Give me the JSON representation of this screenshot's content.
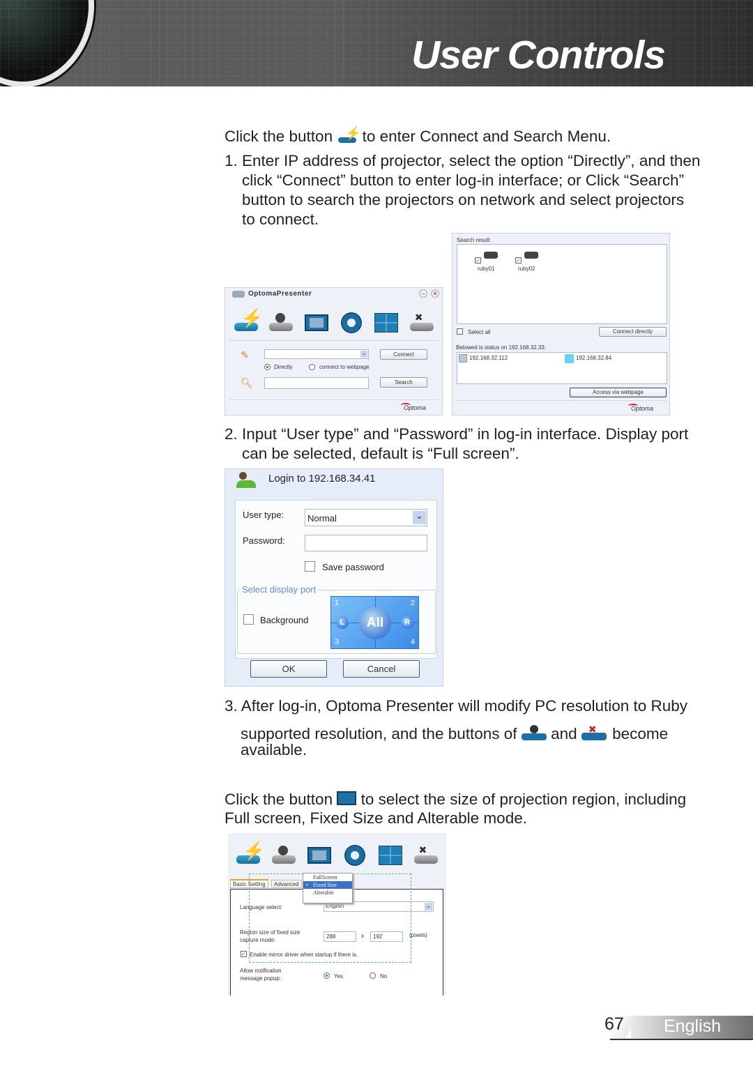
{
  "header": {
    "title": "User Controls"
  },
  "body": {
    "intro_a": "Click the button",
    "intro_b": "to enter Connect and Search Menu.",
    "step1": [
      "1. Enter IP address of projector, select the option “Directly”, and then",
      "click “Connect” button to enter log-in interface; or Click “Search”",
      "button to search the projectors on network and select projectors",
      "to connect."
    ],
    "step2": [
      "2. Input “User type” and “Password” in log-in interface. Display port",
      "can be selected, default is “Full screen”."
    ],
    "step3_a": "3. After log-in, Optoma Presenter will modify PC resolution to Ruby",
    "step3_b": "supported resolution, and the buttons of",
    "step3_and": "and",
    "step3_c": "become",
    "step3_d": "available.",
    "region_a": "Click the button",
    "region_b": "to select the size of projection region, including",
    "region_c": "Full screen, Fixed Size and Alterable mode."
  },
  "presenter": {
    "title": "OptomaPresenter",
    "connect": "Connect",
    "search": "Search",
    "radio_directly": "Directly",
    "radio_webpage": "connect to webpage",
    "logo": "Optoma",
    "icons": [
      "connect-search-icon",
      "play-projector-icon",
      "display-region-icon",
      "settings-gear-icon",
      "split-screen-icon",
      "disconnect-projector-icon"
    ]
  },
  "search_panel": {
    "label": "Search result:",
    "devices": [
      {
        "name": "ruby01",
        "checked": true
      },
      {
        "name": "ruby02",
        "checked": true
      }
    ],
    "select_all": "Select all",
    "connect_directly": "Connect directly",
    "status_label": "Belowed is status on 192.168.32.33:",
    "clients": [
      "192.168.32.112",
      "192.168.32.84"
    ],
    "access": "Access via webpage",
    "logo": "Optoma"
  },
  "login": {
    "title": "Login to 192.168.34.41",
    "user_type_label": "User type:",
    "user_type_value": "Normal",
    "password_label": "Password:",
    "password_value": "",
    "save_password": "Save password",
    "save_password_checked": false,
    "port_group": "Select display port",
    "background": "Background",
    "background_checked": false,
    "ports": {
      "p1": "1",
      "p2": "2",
      "p3": "3",
      "p4": "4",
      "left": "L",
      "all": "All",
      "right": "R"
    },
    "ok": "OK",
    "cancel": "Cancel"
  },
  "settings": {
    "tabs": [
      "Basic Setting",
      "Advanced"
    ],
    "menu": [
      "FullScreen",
      "Fixed Size",
      "Alterable"
    ],
    "menu_selected": "Fixed Size",
    "language_label": "Language select:",
    "language_value": "English",
    "region_label": [
      "Region size of fixed size",
      "capture mode:"
    ],
    "width": "288",
    "x": "x",
    "height": "192",
    "unit": "(pixels)",
    "mirror": "Enable mirror driver when startup if there is.",
    "mirror_checked": true,
    "notify_label": [
      "Allow notification",
      "message popup:"
    ],
    "yes": "Yes",
    "no": "No",
    "notify_value": "Yes"
  },
  "footer": {
    "page": "67",
    "language": "English"
  }
}
